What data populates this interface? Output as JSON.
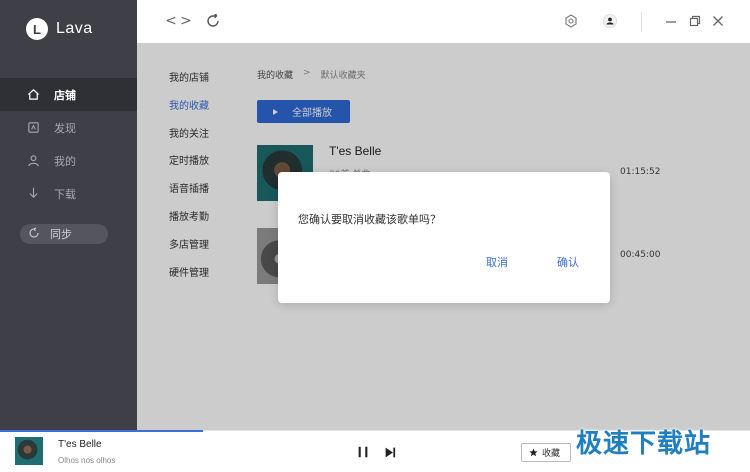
{
  "app": {
    "name": "Lava",
    "logo_letter": "L"
  },
  "sidebar": {
    "items": [
      {
        "label": "店铺",
        "icon": "home-icon",
        "active": true
      },
      {
        "label": "发现",
        "icon": "discover-icon",
        "active": false
      },
      {
        "label": "我的",
        "icon": "user-icon",
        "active": false
      },
      {
        "label": "下载",
        "icon": "download-icon",
        "active": false
      }
    ],
    "sync_label": "同步"
  },
  "topbar": {
    "back": "<",
    "forward": ">"
  },
  "subnav": {
    "items": [
      "我的店铺",
      "我的收藏",
      "我的关注",
      "定时播放",
      "语音插播",
      "播放考勤",
      "多店管理",
      "硬件管理"
    ],
    "active_index": 1
  },
  "breadcrumb": {
    "parent": "我的收藏",
    "separator": ">",
    "current": "默认收藏夹"
  },
  "play_all_label": "全部播放",
  "tracks": [
    {
      "title": "T'es Belle",
      "subtitle": "30首 单曲",
      "duration": "01:15:52"
    },
    {
      "title": "",
      "subtitle": "",
      "duration": "00:45:00"
    }
  ],
  "dialog": {
    "message": "您确认要取消收藏该歌单吗？",
    "cancel_label": "取消",
    "confirm_label": "确认"
  },
  "player": {
    "title": "T'es Belle",
    "subtitle": "Olhos nos olhos",
    "favorite_label": "收藏",
    "progress": 0.27
  },
  "watermark": "极速下载站",
  "colors": {
    "accent": "#3a6fd8",
    "button": "#2f6bd6",
    "rail": "#3f3f47"
  }
}
